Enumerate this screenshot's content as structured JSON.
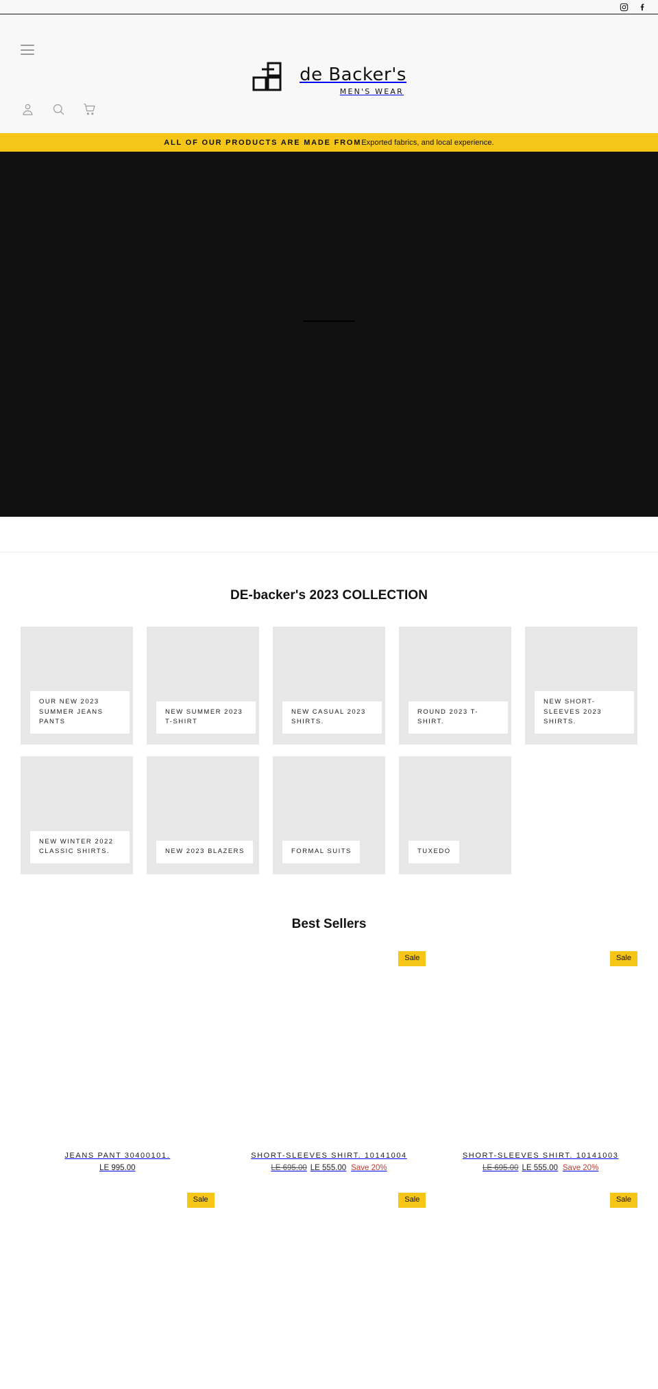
{
  "topbar": {
    "social": [
      {
        "name": "instagram-icon",
        "label": "Instagram"
      },
      {
        "name": "facebook-icon",
        "label": "Facebook"
      }
    ]
  },
  "header": {
    "menu_label": "Menu",
    "logo_name": "de Backer's",
    "logo_sub": "MEN'S WEAR",
    "utils": [
      {
        "name": "account-icon",
        "label": "Log in"
      },
      {
        "name": "search-icon",
        "label": "Search"
      },
      {
        "name": "cart-icon",
        "label": "Cart"
      }
    ]
  },
  "announcement": {
    "strong": "ALL OF OUR PRODUCTS ARE MADE FROM",
    "normal": "Exported fabrics, and local experience.",
    "background": "#f5c518"
  },
  "hero": {
    "background": "#111111"
  },
  "collection": {
    "title": "DE-backer's 2023 COLLECTION",
    "row1": [
      {
        "label": "OUR NEW 2023 SUMMER JEANS PANTS"
      },
      {
        "label": "NEW SUMMER 2023 T-SHIRT"
      },
      {
        "label": "NEW CASUAL 2023 SHIRTS."
      },
      {
        "label": "ROUND 2023 T-SHIRT."
      },
      {
        "label": "NEW SHORT-SLEEVES 2023 SHIRTS."
      }
    ],
    "row2": [
      {
        "label": "NEW WINTER 2022 CLASSIC SHIRTS."
      },
      {
        "label": "NEW 2023 BLAZERS"
      },
      {
        "label": "FORMAL SUITS"
      },
      {
        "label": "TUXEDO"
      }
    ]
  },
  "best_sellers": {
    "title": "Best Sellers",
    "sale_label": "Sale",
    "row1": [
      {
        "title": "JEANS PANT 30400101.",
        "on_sale": false,
        "price_was": "",
        "price_now": "LE 995.00",
        "price_save": ""
      },
      {
        "title": "SHORT-SLEEVES SHIRT. 10141004",
        "on_sale": true,
        "price_was": "LE 695.00",
        "price_now": "LE 555.00",
        "price_save": "Save 20%"
      },
      {
        "title": "SHORT-SLEEVES SHIRT. 10141003",
        "on_sale": true,
        "price_was": "LE 695.00",
        "price_now": "LE 555.00",
        "price_save": "Save 20%"
      }
    ],
    "row2": [
      {
        "on_sale": true
      },
      {
        "on_sale": true
      },
      {
        "on_sale": true
      }
    ]
  }
}
